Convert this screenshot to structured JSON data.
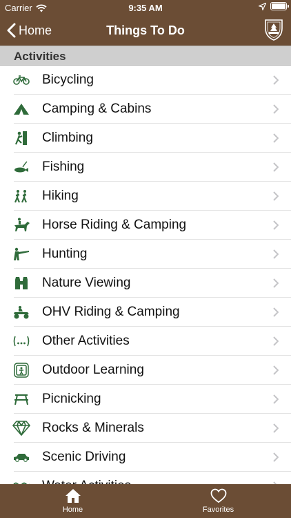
{
  "status": {
    "carrier": "Carrier",
    "time": "9:35 AM"
  },
  "nav": {
    "back_label": "Home",
    "title": "Things To Do"
  },
  "section": {
    "title": "Activities"
  },
  "activities": [
    {
      "label": "Bicycling",
      "icon": "bicycle-icon"
    },
    {
      "label": "Camping & Cabins",
      "icon": "tent-icon"
    },
    {
      "label": "Climbing",
      "icon": "climber-icon"
    },
    {
      "label": "Fishing",
      "icon": "fish-icon"
    },
    {
      "label": "Hiking",
      "icon": "hikers-icon"
    },
    {
      "label": "Horse Riding & Camping",
      "icon": "horse-rider-icon"
    },
    {
      "label": "Hunting",
      "icon": "hunter-icon"
    },
    {
      "label": "Nature Viewing",
      "icon": "binoculars-icon"
    },
    {
      "label": "OHV Riding & Camping",
      "icon": "atv-icon"
    },
    {
      "label": "Other Activities",
      "icon": "ellipsis-icon"
    },
    {
      "label": "Outdoor Learning",
      "icon": "learning-icon"
    },
    {
      "label": "Picnicking",
      "icon": "picnic-table-icon"
    },
    {
      "label": "Rocks & Minerals",
      "icon": "diamond-icon"
    },
    {
      "label": "Scenic Driving",
      "icon": "car-icon"
    },
    {
      "label": "Water Activities",
      "icon": "water-icon"
    }
  ],
  "tabs": [
    {
      "label": "Home",
      "icon": "home-icon"
    },
    {
      "label": "Favorites",
      "icon": "heart-icon"
    }
  ],
  "colors": {
    "bar": "#6b4d35",
    "icon": "#2f6b3a",
    "section": "#cfcfcf"
  }
}
